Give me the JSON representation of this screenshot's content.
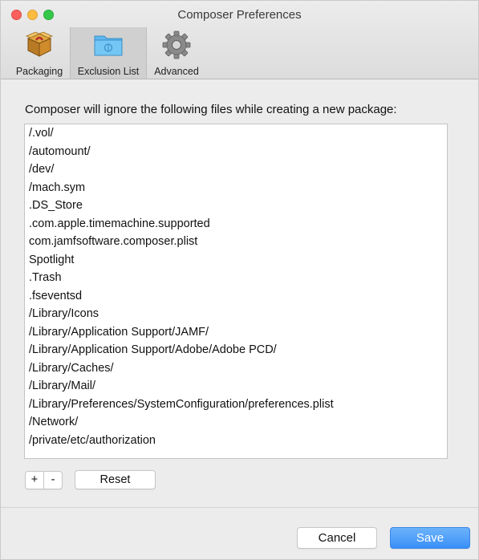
{
  "window": {
    "title": "Composer Preferences"
  },
  "toolbar": {
    "tabs": [
      {
        "label": "Packaging",
        "icon": "package-icon"
      },
      {
        "label": "Exclusion List",
        "icon": "folder-icon",
        "selected": true
      },
      {
        "label": "Advanced",
        "icon": "gear-icon"
      }
    ]
  },
  "exclusion": {
    "description": "Composer will ignore the following files while creating a new package:",
    "items": [
      "/.vol/",
      "/automount/",
      "/dev/",
      "/mach.sym",
      ".DS_Store",
      ".com.apple.timemachine.supported",
      "com.jamfsoftware.composer.plist",
      "Spotlight",
      ".Trash",
      ".fseventsd",
      "/Library/Icons",
      "/Library/Application Support/JAMF/",
      "/Library/Application Support/Adobe/Adobe PCD/",
      "/Library/Caches/",
      "/Library/Mail/",
      "/Library/Preferences/SystemConfiguration/preferences.plist",
      "/Network/",
      "/private/etc/authorization"
    ],
    "add_label": "+",
    "remove_label": "-",
    "reset_label": "Reset"
  },
  "footer": {
    "cancel_label": "Cancel",
    "save_label": "Save"
  },
  "colors": {
    "accent": "#3a8ff8",
    "close": "#fc605c",
    "minimize": "#fdbc40",
    "maximize": "#34c84a"
  }
}
